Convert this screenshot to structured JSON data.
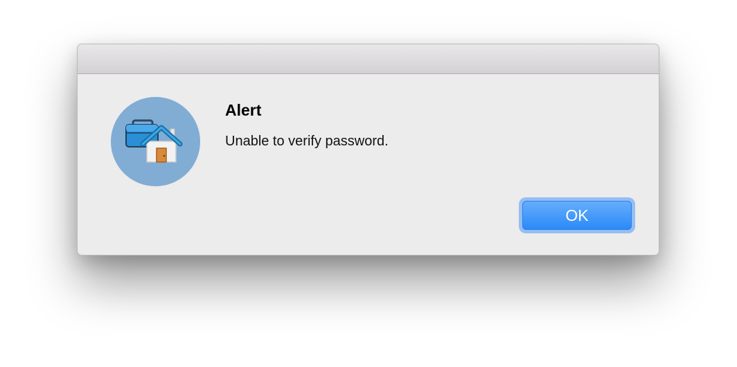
{
  "alert": {
    "title": "Alert",
    "message": "Unable to verify password.",
    "ok_label": "OK",
    "icon": "home-briefcase-icon"
  },
  "colors": {
    "accent": "#2a89f8",
    "icon_circle": "#81acd4",
    "window_bg": "#ececec"
  }
}
